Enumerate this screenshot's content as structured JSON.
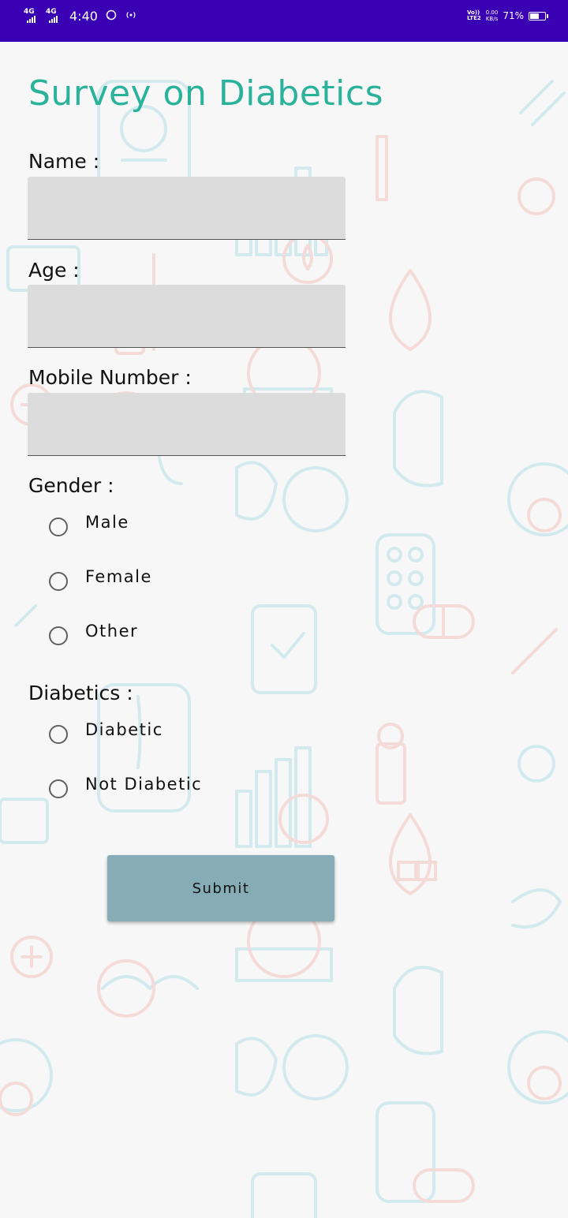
{
  "status_bar": {
    "network_1": "4G",
    "network_2": "4G",
    "time": "4:40",
    "volte_line1": "Vo))",
    "volte_line2": "LTE2",
    "speed_value": "0.00",
    "speed_unit": "KB/s",
    "battery_pct": "71%",
    "battery_level": 0.71,
    "bg_color": "#3a00b4"
  },
  "form": {
    "title": "Survey on Diabetics",
    "name_label": "Name :",
    "name_value": "",
    "age_label": "Age :",
    "age_value": "",
    "mobile_label": "Mobile Number :",
    "mobile_value": "",
    "gender_label": "Gender :",
    "gender_options": [
      "Male",
      "Female",
      "Other"
    ],
    "diabetics_label": "Diabetics :",
    "diabetics_options": [
      "Diabetic",
      "Not Diabetic"
    ],
    "submit_label": "Submit"
  },
  "colors": {
    "title": "#2ab39a",
    "input_bg": "#dcdcdc",
    "button_bg": "#86adb6",
    "pattern_teal": "#8fd3df",
    "pattern_red": "#f0a8a0"
  },
  "icons": {
    "whatsapp": "whatsapp-icon",
    "hotspot": "hotspot-icon",
    "battery": "battery-icon"
  }
}
